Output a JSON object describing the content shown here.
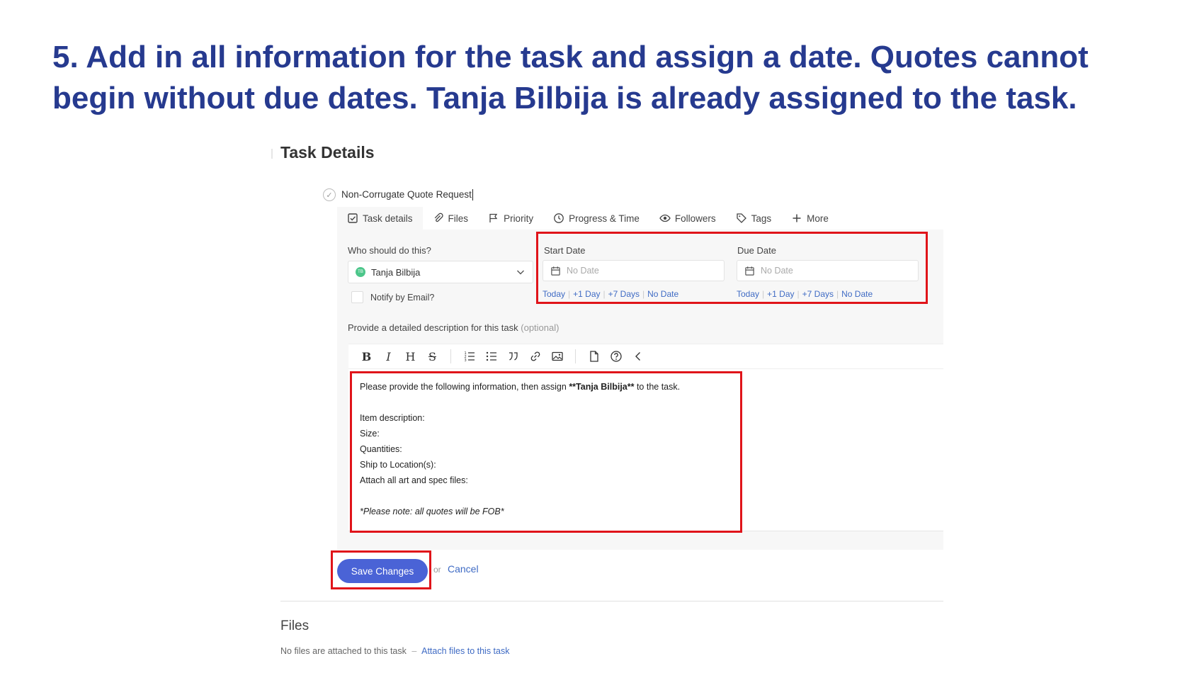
{
  "heading": "5. Add in all information for the task and assign a date. Quotes cannot begin without due dates. Tanja Bilbija is already assigned to the task.",
  "section_title": "Task Details",
  "task": {
    "name": "Non-Corrugate Quote Request"
  },
  "tabs": [
    {
      "label": "Task details",
      "icon": "checkbox-icon"
    },
    {
      "label": "Files",
      "icon": "paperclip-icon"
    },
    {
      "label": "Priority",
      "icon": "flag-icon"
    },
    {
      "label": "Progress & Time",
      "icon": "clock-icon"
    },
    {
      "label": "Followers",
      "icon": "eye-icon"
    },
    {
      "label": "Tags",
      "icon": "tag-icon"
    },
    {
      "label": "More",
      "icon": "plus-icon"
    }
  ],
  "assignee": {
    "label": "Who should do this?",
    "value": "Tanja Bilbija",
    "initials": "TB",
    "notify_label": "Notify by Email?"
  },
  "start_date": {
    "label": "Start Date",
    "placeholder": "No Date",
    "quick": [
      "Today",
      "+1 Day",
      "+7 Days",
      "No Date"
    ]
  },
  "due_date": {
    "label": "Due Date",
    "placeholder": "No Date",
    "quick": [
      "Today",
      "+1 Day",
      "+7 Days",
      "No Date"
    ]
  },
  "description": {
    "label": "Provide a detailed description for this task",
    "optional": "(optional)",
    "line1_prefix": "Please provide the following information, then assign ",
    "line1_bold": "**Tanja Bilbija**",
    "line1_suffix": " to the task.",
    "item": "Item description:",
    "size": "Size:",
    "quantities": "Quantities:",
    "ship": "Ship to Location(s):",
    "attach": "Attach all art and spec files:",
    "note": "*Please note: all quotes will be FOB*"
  },
  "actions": {
    "save": "Save Changes",
    "or": "or",
    "cancel": "Cancel"
  },
  "files": {
    "title": "Files",
    "empty": "No files are attached to this task",
    "dash": "–",
    "attach_link": "Attach files to this task"
  },
  "colors": {
    "heading": "#263a8f",
    "accent": "#4a63d6",
    "highlight": "#e0141a",
    "link": "#3f6bc4"
  }
}
